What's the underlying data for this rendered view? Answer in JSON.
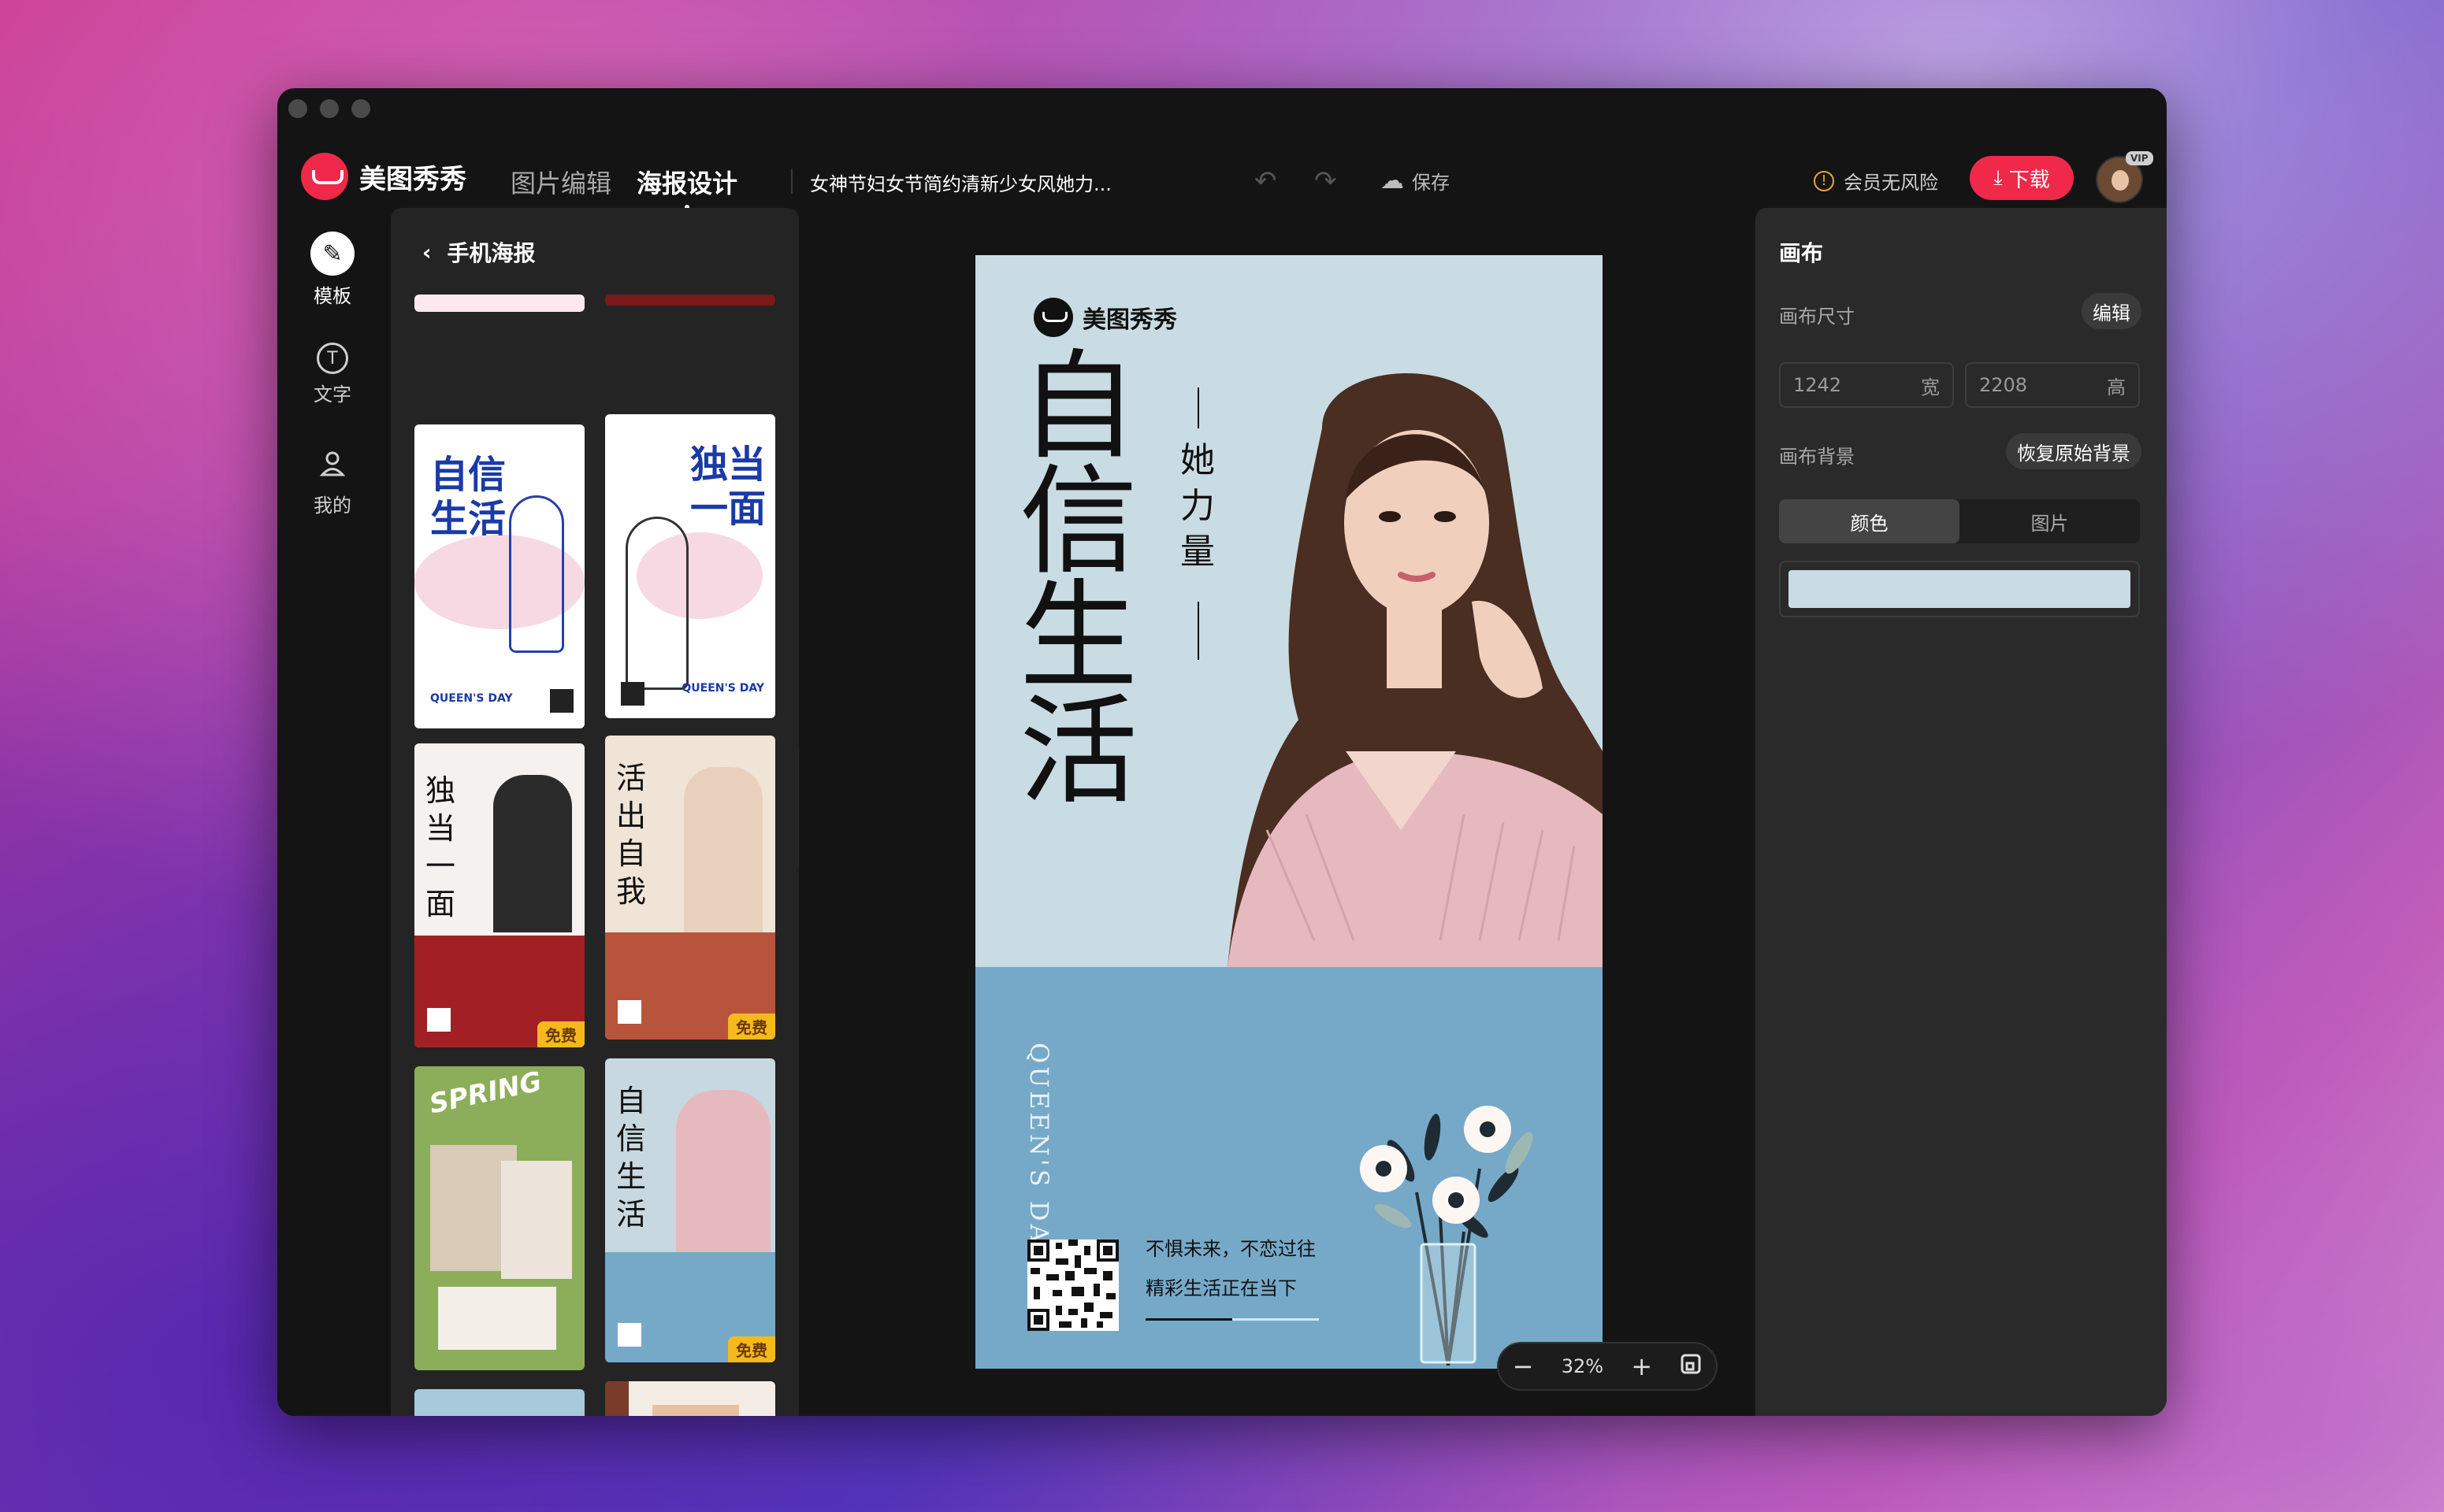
{
  "app": {
    "logo_text": "美图秀秀",
    "nav": [
      {
        "label": "图片编辑"
      },
      {
        "label": "海报设计"
      }
    ],
    "doc_title": "女神节妇女节简约清新少女风她力...",
    "save_label": "保存",
    "vip_text": "会员无风险",
    "download_label": "下载",
    "avatar_badge": "VIP"
  },
  "rail": [
    {
      "label": "模板",
      "icon": "template-edit-icon"
    },
    {
      "label": "文字",
      "icon": "text-icon",
      "glyph": "T"
    },
    {
      "label": "我的",
      "icon": "user-icon"
    }
  ],
  "panel": {
    "title": "手机海报",
    "thumbs": [
      {
        "title1": "自信",
        "title2": "生活",
        "footer": "QUEEN'S DAY"
      },
      {
        "title1": "独当",
        "title2": "一面",
        "footer": "QUEEN'S DAY"
      },
      {
        "title1": "独当",
        "title2": "一面",
        "badge": "免费"
      },
      {
        "title1": "活出",
        "title2": "自我",
        "badge": "免费"
      },
      {
        "title1": "SPRING",
        "badge": ""
      },
      {
        "title1": "自信",
        "title2": "生活",
        "badge": "免费"
      }
    ]
  },
  "poster": {
    "logo_text": "美图秀秀",
    "title_chars": [
      "自",
      "信",
      "生",
      "活"
    ],
    "subtitle_chars": [
      "她",
      "力",
      "量"
    ],
    "queen": "QUEEN'S DAY",
    "line1": "不惧未来，不恋过往",
    "line2": "精彩生活正在当下"
  },
  "zoom": {
    "value": "32%"
  },
  "right": {
    "title": "画布",
    "size_label": "画布尺寸",
    "edit_label": "编辑",
    "width_value": "1242",
    "width_unit": "宽",
    "height_value": "2208",
    "height_unit": "高",
    "bg_label": "画布背景",
    "restore_label": "恢复原始背景",
    "tab_color": "颜色",
    "tab_image": "图片",
    "bg_color": "#c9dbe3"
  },
  "colors": {
    "accent": "#f0284a",
    "poster_bottom": "#76a9c8"
  }
}
